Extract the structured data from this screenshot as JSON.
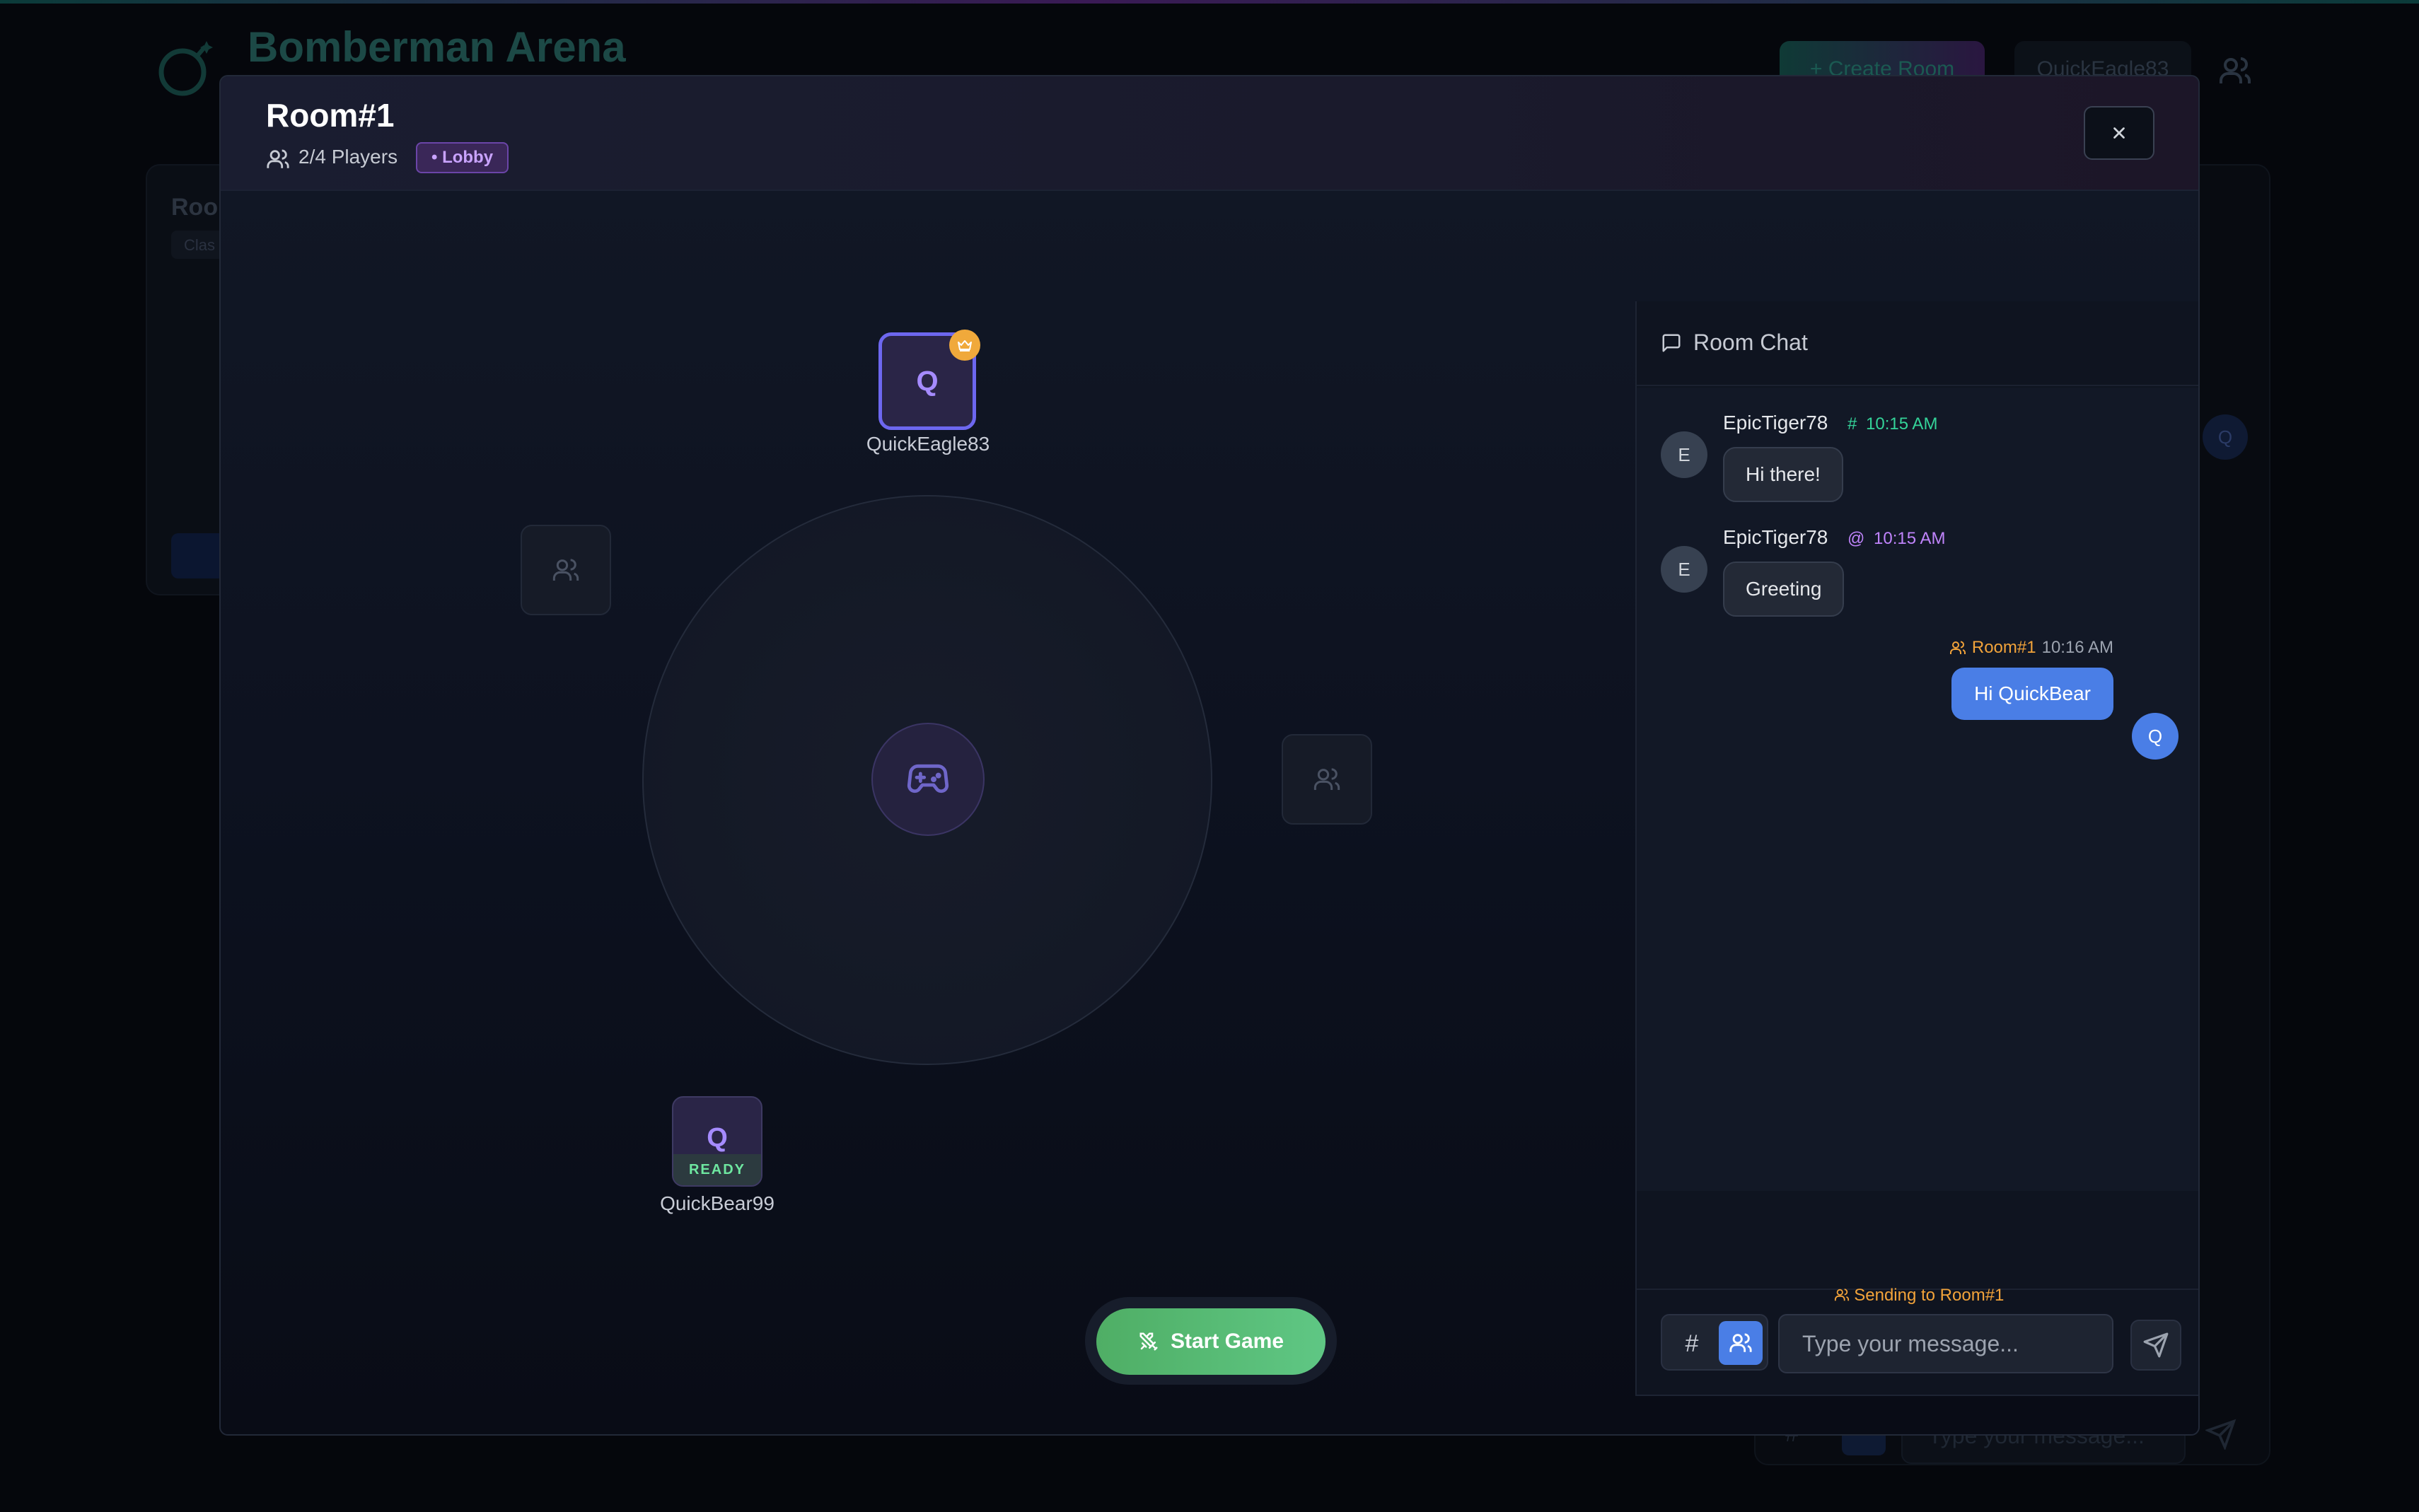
{
  "app": {
    "title": "Bomberman Arena",
    "create_room_label": "+ Create Room",
    "username": "QuickEagle83",
    "bg_card_title": "Roo",
    "bg_card_tag": "Clas",
    "bg_avatar": "Q",
    "bg_chat_placeholder": "Type your message..."
  },
  "modal": {
    "room_title": "Room#1",
    "players_count": "2/4 Players",
    "status_badge": "• Lobby",
    "close_label": "×"
  },
  "arena": {
    "host": {
      "initial": "Q",
      "name": "QuickEagle83",
      "is_host": true
    },
    "player2": {
      "initial": "Q",
      "name": "QuickBear99",
      "ready_label": "READY"
    },
    "start_label": "Start Game"
  },
  "chat": {
    "title": "Room Chat",
    "messages": [
      {
        "initial": "E",
        "name": "EpicTiger78",
        "channel_icon": "#",
        "time": "10:15 AM",
        "text": "Hi there!",
        "meta_color": "#34d399"
      },
      {
        "initial": "E",
        "name": "EpicTiger78",
        "channel_icon": "@",
        "time": "10:15 AM",
        "text": "Greeting",
        "meta_color": "#c084fc"
      },
      {
        "initial": "Q",
        "room": "Room#1",
        "time": "10:16 AM",
        "text": "Hi QuickBear",
        "room_color": "#f2a33a"
      }
    ],
    "sending_to": "Sending to Room#1",
    "hash_label": "#",
    "input_placeholder": "Type your message..."
  },
  "colors": {
    "accent_blue": "#4a7ee6",
    "ready_green": "#6ee7a0",
    "start_green": "#5fc784",
    "host_border": "#6d67ef",
    "crown": "#f0a93b",
    "lobby_purple": "#c9a3ff"
  },
  "icons": {
    "logo": "bomb-icon",
    "players": "users-icon",
    "close": "close-icon",
    "crown": "crown-icon",
    "center": "gamepad-icon",
    "empty_slot": "users-icon",
    "start": "swords-icon",
    "chat": "message-square-icon",
    "send": "send-icon"
  }
}
